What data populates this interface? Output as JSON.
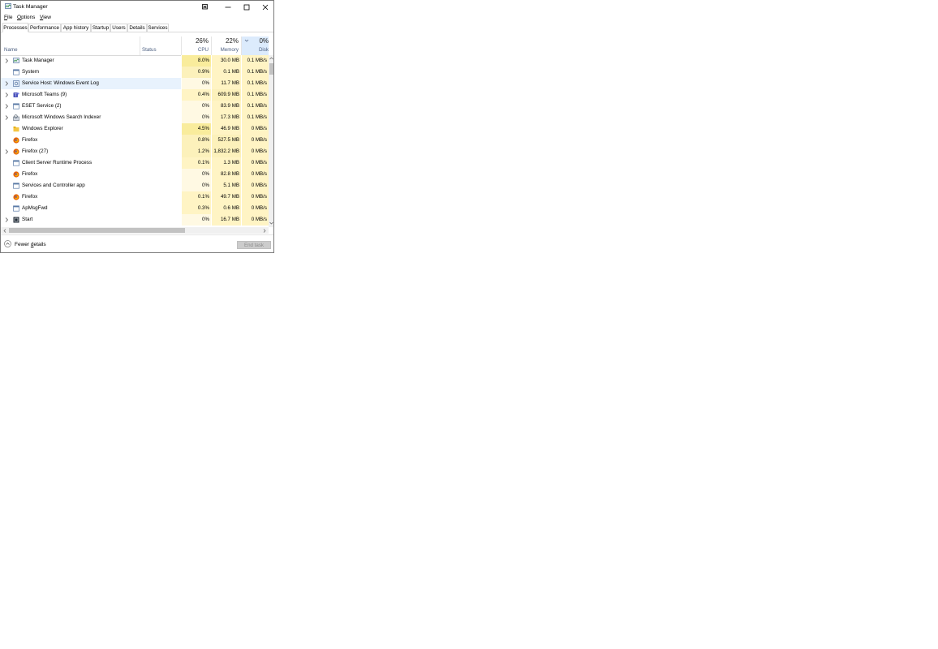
{
  "window": {
    "title": "Task Manager"
  },
  "menu": [
    {
      "label_pre": "",
      "label_ul": "F",
      "label_post": "ile"
    },
    {
      "label_pre": "",
      "label_ul": "O",
      "label_post": "ptions"
    },
    {
      "label_pre": "",
      "label_ul": "V",
      "label_post": "iew"
    }
  ],
  "tabs": [
    "Processes",
    "Performance",
    "App history",
    "Startup",
    "Users",
    "Details",
    "Services"
  ],
  "active_tab": "Processes",
  "columns": {
    "name": "Name",
    "status": "Status",
    "cpu": {
      "label": "CPU",
      "pct": "26%"
    },
    "memory": {
      "label": "Memory",
      "pct": "22%"
    },
    "disk": {
      "label": "Disk",
      "pct": "0%"
    }
  },
  "rows": [
    {
      "name": "Task Manager",
      "icon": "task-manager-icon",
      "expandable": true,
      "cpu": "8.0%",
      "mem": "30.0 MB",
      "disk": "0.1 MB/s"
    },
    {
      "name": "System",
      "icon": "window-process-icon",
      "expandable": false,
      "cpu": "0.9%",
      "mem": "0.1 MB",
      "disk": "0.1 MB/s"
    },
    {
      "name": "Service Host: Windows Event Log",
      "icon": "service-host-icon",
      "expandable": true,
      "cpu": "0%",
      "mem": "11.7 MB",
      "disk": "0.1 MB/s",
      "selected": true
    },
    {
      "name": "Microsoft Teams (9)",
      "icon": "teams-icon",
      "expandable": true,
      "cpu": "0.4%",
      "mem": "609.9 MB",
      "disk": "0.1 MB/s"
    },
    {
      "name": "ESET Service (2)",
      "icon": "window-process-icon",
      "expandable": true,
      "cpu": "0%",
      "mem": "83.9 MB",
      "disk": "0.1 MB/s"
    },
    {
      "name": "Microsoft Windows Search Indexer",
      "icon": "search-indexer-icon",
      "expandable": true,
      "cpu": "0%",
      "mem": "17.3 MB",
      "disk": "0.1 MB/s"
    },
    {
      "name": "Windows Explorer",
      "icon": "explorer-icon",
      "expandable": false,
      "cpu": "4.5%",
      "mem": "46.9 MB",
      "disk": "0 MB/s"
    },
    {
      "name": "Firefox",
      "icon": "firefox-icon",
      "expandable": false,
      "cpu": "0.8%",
      "mem": "527.5 MB",
      "disk": "0 MB/s"
    },
    {
      "name": "Firefox (27)",
      "icon": "firefox-icon",
      "expandable": true,
      "cpu": "1.2%",
      "mem": "1,832.2 MB",
      "disk": "0 MB/s"
    },
    {
      "name": "Client Server Runtime Process",
      "icon": "window-process-icon",
      "expandable": false,
      "cpu": "0.1%",
      "mem": "1.3 MB",
      "disk": "0 MB/s"
    },
    {
      "name": "Firefox",
      "icon": "firefox-icon",
      "expandable": false,
      "cpu": "0%",
      "mem": "82.8 MB",
      "disk": "0 MB/s"
    },
    {
      "name": "Services and Controller app",
      "icon": "window-process-icon",
      "expandable": false,
      "cpu": "0%",
      "mem": "5.1 MB",
      "disk": "0 MB/s"
    },
    {
      "name": "Firefox",
      "icon": "firefox-icon",
      "expandable": false,
      "cpu": "0.1%",
      "mem": "49.7 MB",
      "disk": "0 MB/s"
    },
    {
      "name": "ApMsgFwd",
      "icon": "window-process-icon",
      "expandable": false,
      "cpu": "0.3%",
      "mem": "0.6 MB",
      "disk": "0 MB/s"
    },
    {
      "name": "Start",
      "icon": "start-icon",
      "expandable": true,
      "cpu": "0%",
      "mem": "16.7 MB",
      "disk": "0 MB/s"
    }
  ],
  "footer": {
    "fewer_pre": "Fewer ",
    "fewer_ul": "d",
    "fewer_post": "etails",
    "end_task": "End task"
  },
  "colors": {
    "heat_high": "#f9ec9c",
    "heat_mid": "#fcf1bb",
    "heat_low": "#fff4c4",
    "heat_none": "#fff9e3",
    "selected_row": "#e8f2fd",
    "sorted_header": "#dcebfc",
    "header_label": "#4d6082"
  }
}
